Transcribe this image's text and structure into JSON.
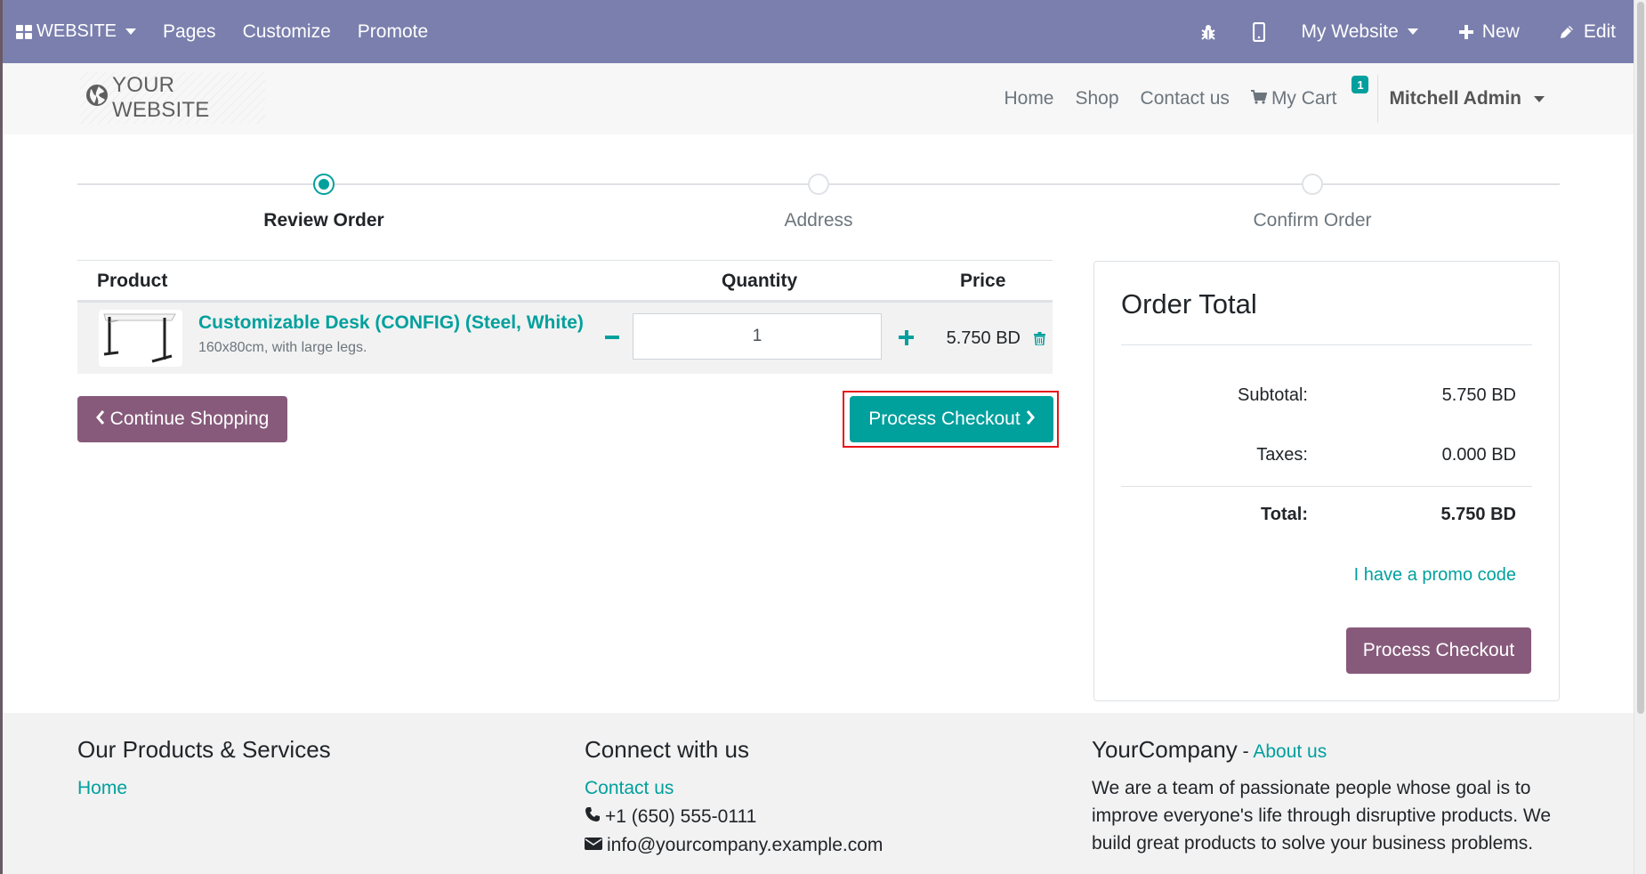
{
  "topbar": {
    "brand": "WEBSITE",
    "menu": [
      "Pages",
      "Customize",
      "Promote"
    ],
    "website_selector": "My Website",
    "new_label": "New",
    "edit_label": "Edit"
  },
  "header": {
    "logo_text": "YOUR WEBSITE",
    "nav": [
      "Home",
      "Shop",
      "Contact us"
    ],
    "cart_label": "My Cart",
    "cart_count": "1",
    "user": "Mitchell Admin"
  },
  "wizard": {
    "steps": [
      {
        "label": "Review Order",
        "active": true
      },
      {
        "label": "Address",
        "active": false
      },
      {
        "label": "Confirm Order",
        "active": false
      }
    ]
  },
  "cart": {
    "headers": {
      "product": "Product",
      "quantity": "Quantity",
      "price": "Price"
    },
    "lines": [
      {
        "name": "Customizable Desk (CONFIG) (Steel, White)",
        "description": "160x80cm, with large legs.",
        "quantity": "1",
        "price": "5.750 BD"
      }
    ],
    "continue_label": "Continue Shopping",
    "checkout_label": "Process Checkout"
  },
  "order_total": {
    "title": "Order Total",
    "subtotal_label": "Subtotal:",
    "subtotal": "5.750 BD",
    "taxes_label": "Taxes:",
    "taxes": "0.000 BD",
    "total_label": "Total:",
    "total": "5.750 BD",
    "promo_label": "I have a promo code",
    "checkout_label": "Process Checkout"
  },
  "footer": {
    "col1_title": "Our Products & Services",
    "col1_link": "Home",
    "col2_title": "Connect with us",
    "col2_link": "Contact us",
    "phone": "+1 (650) 555-0111",
    "email": "info@yourcompany.example.com",
    "col3_title": "YourCompany",
    "col3_sep": " - ",
    "col3_about": "About us",
    "col3_text": "We are a team of passionate people whose goal is to improve everyone's life through disruptive products. We build great products to solve your business problems."
  },
  "colors": {
    "topbar": "#7a7fad",
    "primary": "#01a09d",
    "secondary": "#875a7b",
    "highlight": "#e8141a"
  }
}
